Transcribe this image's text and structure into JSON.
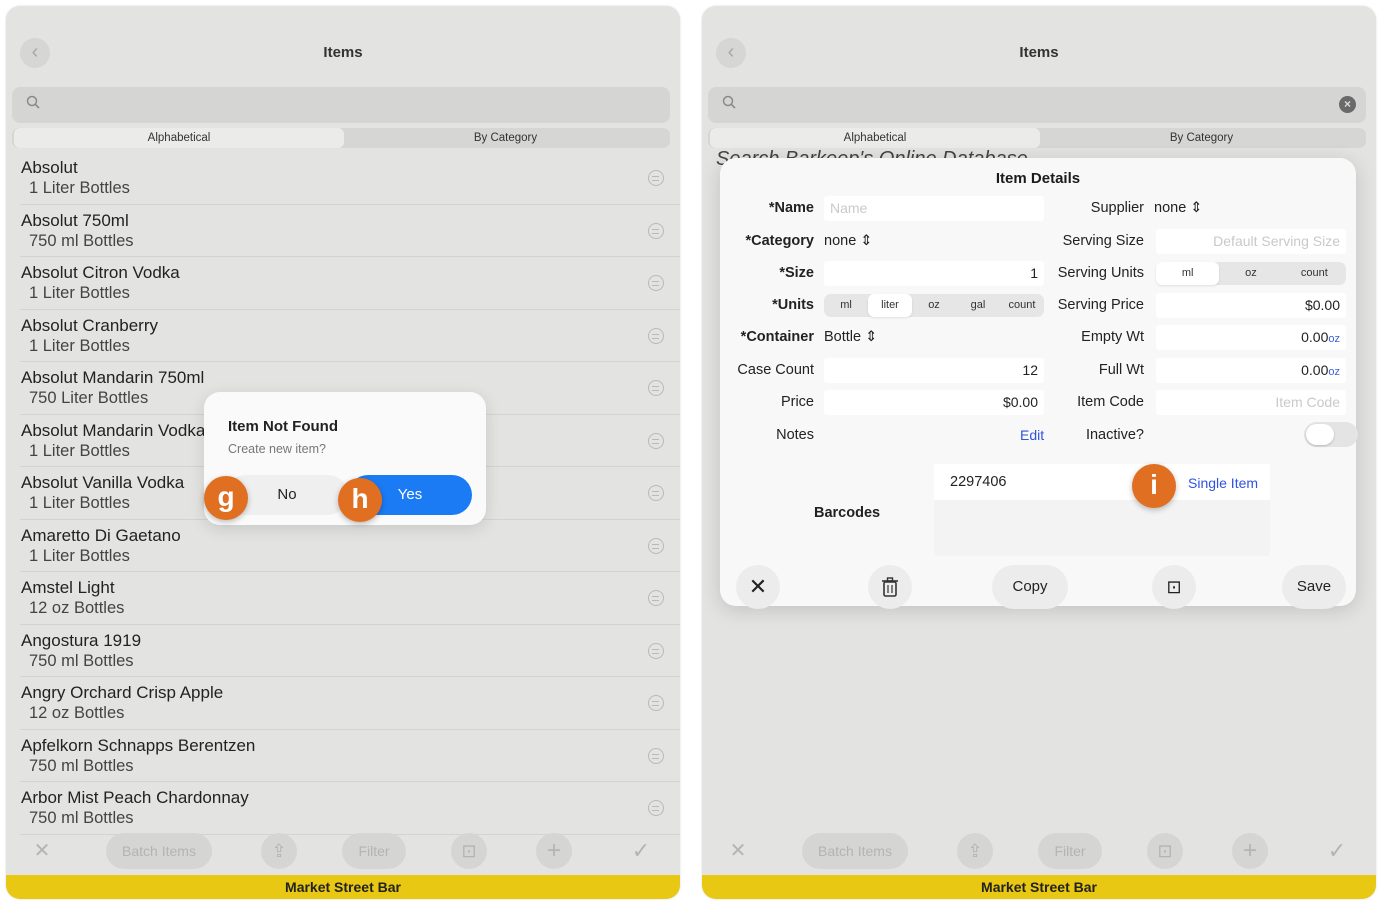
{
  "left": {
    "title": "Items",
    "segments": [
      "Alphabetical",
      "By Category"
    ],
    "items": [
      {
        "name": "Absolut",
        "detail": "1 Liter Bottles"
      },
      {
        "name": "Absolut 750ml",
        "detail": "750 ml Bottles"
      },
      {
        "name": "Absolut Citron Vodka",
        "detail": "1 Liter Bottles"
      },
      {
        "name": "Absolut Cranberry",
        "detail": "1 Liter Bottles"
      },
      {
        "name": "Absolut Mandarin 750ml",
        "detail": "750 Liter Bottles"
      },
      {
        "name": "Absolut Mandarin Vodka",
        "detail": "1 Liter Bottles"
      },
      {
        "name": "Absolut Vanilla Vodka",
        "detail": "1 Liter Bottles"
      },
      {
        "name": "Amaretto Di Gaetano",
        "detail": "1 Liter Bottles"
      },
      {
        "name": "Amstel Light",
        "detail": "12 oz Bottles"
      },
      {
        "name": "Angostura 1919",
        "detail": "750 ml Bottles"
      },
      {
        "name": "Angry Orchard Crisp Apple",
        "detail": "12 oz Bottles"
      },
      {
        "name": "Apfelkorn Schnapps Berentzen",
        "detail": "750 ml Bottles"
      },
      {
        "name": "Arbor Mist Peach Chardonnay",
        "detail": "750 ml Bottles"
      }
    ],
    "dialog": {
      "title": "Item Not Found",
      "message": "Create new item?",
      "no": "No",
      "yes": "Yes"
    },
    "badges": {
      "g": "g",
      "h": "h"
    }
  },
  "toolbar": {
    "close": "✕",
    "batch": "Batch Items",
    "share": "⇪",
    "filter": "Filter",
    "scan": "⊡",
    "add": "+",
    "check": "✓"
  },
  "footer": "Market Street Bar",
  "right": {
    "title": "Items",
    "segments": [
      "Alphabetical",
      "By Category"
    ],
    "behind_text": "Search Barkeep's Online Database",
    "panel": {
      "title": "Item Details",
      "name_label": "*Name",
      "name_placeholder": "Name",
      "category_label": "*Category",
      "category_value": "none",
      "size_label": "*Size",
      "size_value": "1",
      "units_label": "*Units",
      "units": [
        "ml",
        "liter",
        "oz",
        "gal",
        "count"
      ],
      "units_selected": "liter",
      "container_label": "*Container",
      "container_value": "Bottle",
      "case_label": "Case Count",
      "case_value": "12",
      "price_label": "Price",
      "price_value": "$0.00",
      "notes_label": "Notes",
      "notes_edit": "Edit",
      "supplier_label": "Supplier",
      "supplier_value": "none",
      "serving_size_label": "Serving Size",
      "serving_size_placeholder": "Default Serving Size",
      "serving_units_label": "Serving Units",
      "serving_units": [
        "ml",
        "oz",
        "count"
      ],
      "serving_units_selected": "ml",
      "serving_price_label": "Serving Price",
      "serving_price_value": "$0.00",
      "empty_wt_label": "Empty Wt",
      "empty_wt_value": "0.00",
      "empty_wt_unit": "oz",
      "full_wt_label": "Full Wt",
      "full_wt_value": "0.00",
      "full_wt_unit": "oz",
      "item_code_label": "Item Code",
      "item_code_placeholder": "Item Code",
      "inactive_label": "Inactive?",
      "inactive": false,
      "barcodes_label": "Barcodes",
      "barcode_value": "2297406",
      "barcode_type": "Single Item",
      "badge": "i",
      "copy": "Copy",
      "save": "Save"
    }
  }
}
